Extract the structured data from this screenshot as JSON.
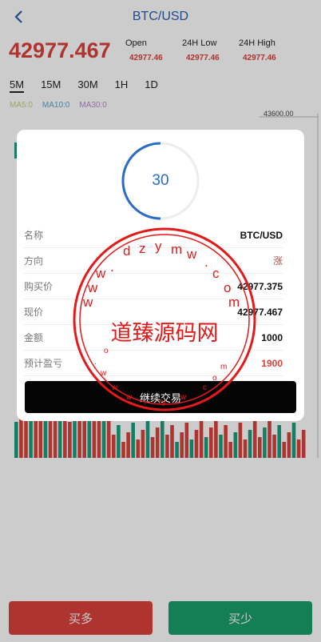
{
  "header": {
    "title": "BTC/USD"
  },
  "ticker": {
    "price": "42977.467",
    "stats": [
      {
        "label": "Open",
        "value": "42977.46"
      },
      {
        "label": "24H Low",
        "value": "42977.46"
      },
      {
        "label": "24H High",
        "value": "42977.46"
      }
    ]
  },
  "periods": [
    "5M",
    "15M",
    "30M",
    "1H",
    "1D"
  ],
  "active_period": "5M",
  "ma": [
    {
      "label": "MA5:0",
      "color": "#c8cf7a"
    },
    {
      "label": "MA10:0",
      "color": "#5aa7c5"
    },
    {
      "label": "MA30:0",
      "color": "#b08cc4"
    }
  ],
  "chart": {
    "axis_top": "43600.00"
  },
  "modal": {
    "countdown": "30",
    "rows": [
      {
        "key": "名称",
        "value": "BTC/USD"
      },
      {
        "key": "方向",
        "value": "涨"
      },
      {
        "key": "购买价",
        "value": "42977.375"
      },
      {
        "key": "现价",
        "value": "42977.467"
      },
      {
        "key": "金额",
        "value": "1000"
      },
      {
        "key": "预计盈亏",
        "value": "1900"
      }
    ],
    "continue_label": "继续交易"
  },
  "watermark": {
    "text": "道臻源码网"
  },
  "footer": {
    "buy_up": "买多",
    "buy_down": "买少"
  },
  "colors": {
    "up": "#d9423b",
    "down": "#1a9e7e",
    "accent": "#2a5dad"
  }
}
